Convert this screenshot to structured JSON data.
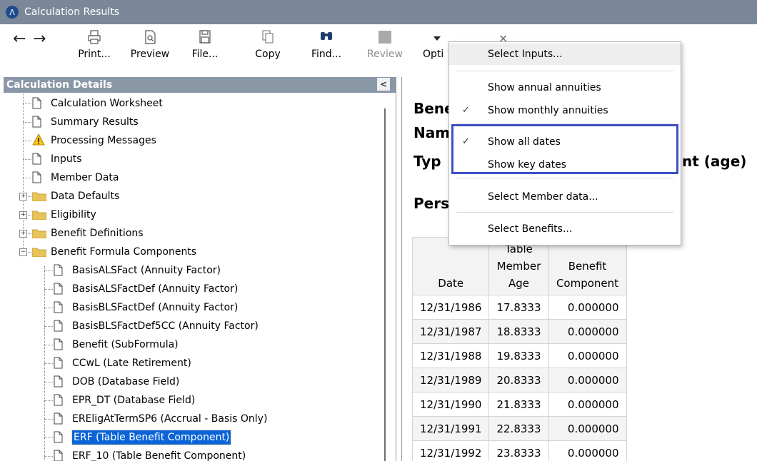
{
  "window": {
    "title": "Calculation Results",
    "app_icon": "actuarial-app-icon"
  },
  "toolbar": {
    "back_icon": "arrow-left-icon",
    "forward_icon": "arrow-right-icon",
    "buttons": [
      {
        "label": "Print...",
        "icon": "printer-icon",
        "enabled": true
      },
      {
        "label": "Preview",
        "icon": "print-preview-icon",
        "enabled": true
      },
      {
        "label": "File...",
        "icon": "save-file-icon",
        "enabled": true
      },
      {
        "label": "Copy",
        "icon": "copy-icon",
        "enabled": true
      },
      {
        "label": "Find...",
        "icon": "binoculars-icon",
        "enabled": true
      },
      {
        "label": "Review",
        "icon": "review-icon",
        "enabled": false
      },
      {
        "label": "Opti",
        "icon": "dropdown-arrow-icon",
        "enabled": true
      }
    ]
  },
  "left_pane": {
    "header": "Calculation Details",
    "collapse_glyph": "<",
    "tree": [
      {
        "label": "Calculation Worksheet",
        "type": "doc",
        "level": 0
      },
      {
        "label": "Summary Results",
        "type": "doc",
        "level": 0
      },
      {
        "label": "Processing Messages",
        "type": "warning",
        "level": 0
      },
      {
        "label": "Inputs",
        "type": "doc",
        "level": 0
      },
      {
        "label": "Member Data",
        "type": "doc",
        "level": 0
      },
      {
        "label": "Data Defaults",
        "type": "folder",
        "level": 0,
        "expander": "+"
      },
      {
        "label": "Eligibility",
        "type": "folder",
        "level": 0,
        "expander": "+"
      },
      {
        "label": "Benefit Definitions",
        "type": "folder",
        "level": 0,
        "expander": "+"
      },
      {
        "label": "Benefit Formula Components",
        "type": "folder",
        "level": 0,
        "expander": "-"
      },
      {
        "label": "BasisALSFact (Annuity Factor)",
        "type": "doc",
        "level": 1
      },
      {
        "label": "BasisALSFactDef (Annuity Factor)",
        "type": "doc",
        "level": 1
      },
      {
        "label": "BasisBLSFactDef (Annuity Factor)",
        "type": "doc",
        "level": 1
      },
      {
        "label": "BasisBLSFactDef5CC (Annuity Factor)",
        "type": "doc",
        "level": 1
      },
      {
        "label": "Benefit (SubFormula)",
        "type": "doc",
        "level": 1
      },
      {
        "label": "CCwL (Late Retirement)",
        "type": "doc",
        "level": 1
      },
      {
        "label": "DOB (Database Field)",
        "type": "doc",
        "level": 1
      },
      {
        "label": "EPR_DT (Database Field)",
        "type": "doc",
        "level": 1
      },
      {
        "label": "EREligAtTermSP6 (Accrual - Basis Only)",
        "type": "doc",
        "level": 1
      },
      {
        "label": "ERF (Table Benefit Component)",
        "type": "doc",
        "level": 1,
        "selected": true
      },
      {
        "label": "ERF_10 (Table Benefit Component)",
        "type": "doc",
        "level": 1
      }
    ]
  },
  "right_pane": {
    "heading_lines": [
      "Bene",
      "Nam",
      "Typ"
    ],
    "heading_right_fragment": "nt (age)",
    "section_heading": "Pers",
    "table": {
      "columns": [
        "Date",
        "Table\nMember\nAge",
        "Benefit\nComponent"
      ],
      "rows": [
        [
          "12/31/1986",
          "17.8333",
          "0.000000"
        ],
        [
          "12/31/1987",
          "18.8333",
          "0.000000"
        ],
        [
          "12/31/1988",
          "19.8333",
          "0.000000"
        ],
        [
          "12/31/1989",
          "20.8333",
          "0.000000"
        ],
        [
          "12/31/1990",
          "21.8333",
          "0.000000"
        ],
        [
          "12/31/1991",
          "22.8333",
          "0.000000"
        ],
        [
          "12/31/1992",
          "23.8333",
          "0.000000"
        ]
      ]
    }
  },
  "options_menu": {
    "items": [
      {
        "label": "Select Inputs...",
        "checked": false,
        "hover": true
      },
      {
        "label": "Show annual annuities",
        "checked": false
      },
      {
        "label": "Show monthly annuities",
        "checked": true
      },
      {
        "label": "Show all dates",
        "checked": true
      },
      {
        "label": "Show key dates",
        "checked": false
      },
      {
        "label": "Select Member data...",
        "checked": false
      },
      {
        "label": "Select Benefits...",
        "checked": false
      }
    ],
    "check_glyph": "✓",
    "annotation_color": "#3d4fc4"
  },
  "colors": {
    "titlebar": "#7a8899",
    "pane_header": "#8a97a7",
    "selection": "#0a64d8"
  }
}
